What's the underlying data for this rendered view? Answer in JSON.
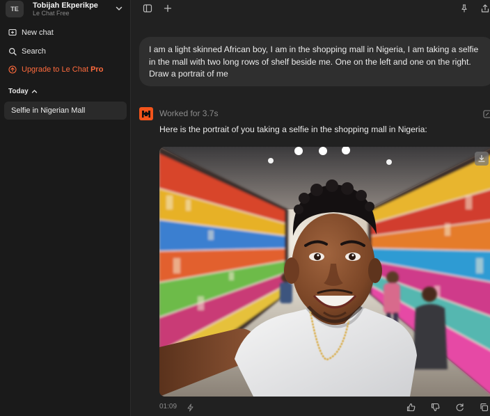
{
  "account": {
    "initials": "TE",
    "name": "Tobijah Ekperikpe",
    "plan": "Le Chat Free"
  },
  "sidebar": {
    "new_chat": "New chat",
    "search": "Search",
    "upgrade_prefix": "Upgrade to Le Chat ",
    "upgrade_highlight": "Pro",
    "section_today": "Today",
    "history": [
      {
        "title": "Selfie in Nigerian Mall"
      }
    ]
  },
  "conversation": {
    "user_message": "I am a light skinned African boy, I am in the shopping mall in Nigeria, I am taking a selfie in the mall with two long rows of shelf beside me. One on the left and one on the right. Draw a portrait of me",
    "worked_for": "Worked for 3.7s",
    "assistant_text": "Here is the portrait of you taking a selfie in the shopping mall in Nigeria:",
    "timestamp": "01:09"
  },
  "colors": {
    "accent": "#f2541b",
    "upgrade": "#ff6b3d",
    "sidebar_bg": "#1a1a1a",
    "main_bg": "#212121",
    "bubble_bg": "#2f2f2f"
  },
  "icons": {
    "account_chevron": "chevron-down-icon",
    "new_chat": "chat-plus-icon",
    "search": "search-icon",
    "upgrade": "upgrade-arrow-icon",
    "section_toggle": "chevron-up-icon",
    "sidebar_toggle": "sidebar-toggle-icon",
    "new_tab": "plus-icon",
    "pin": "pin-icon",
    "share": "share-icon",
    "download": "download-icon",
    "thumbs_up": "thumbs-up-icon",
    "thumbs_down": "thumbs-down-icon",
    "regenerate": "regenerate-icon",
    "copy": "copy-icon"
  }
}
